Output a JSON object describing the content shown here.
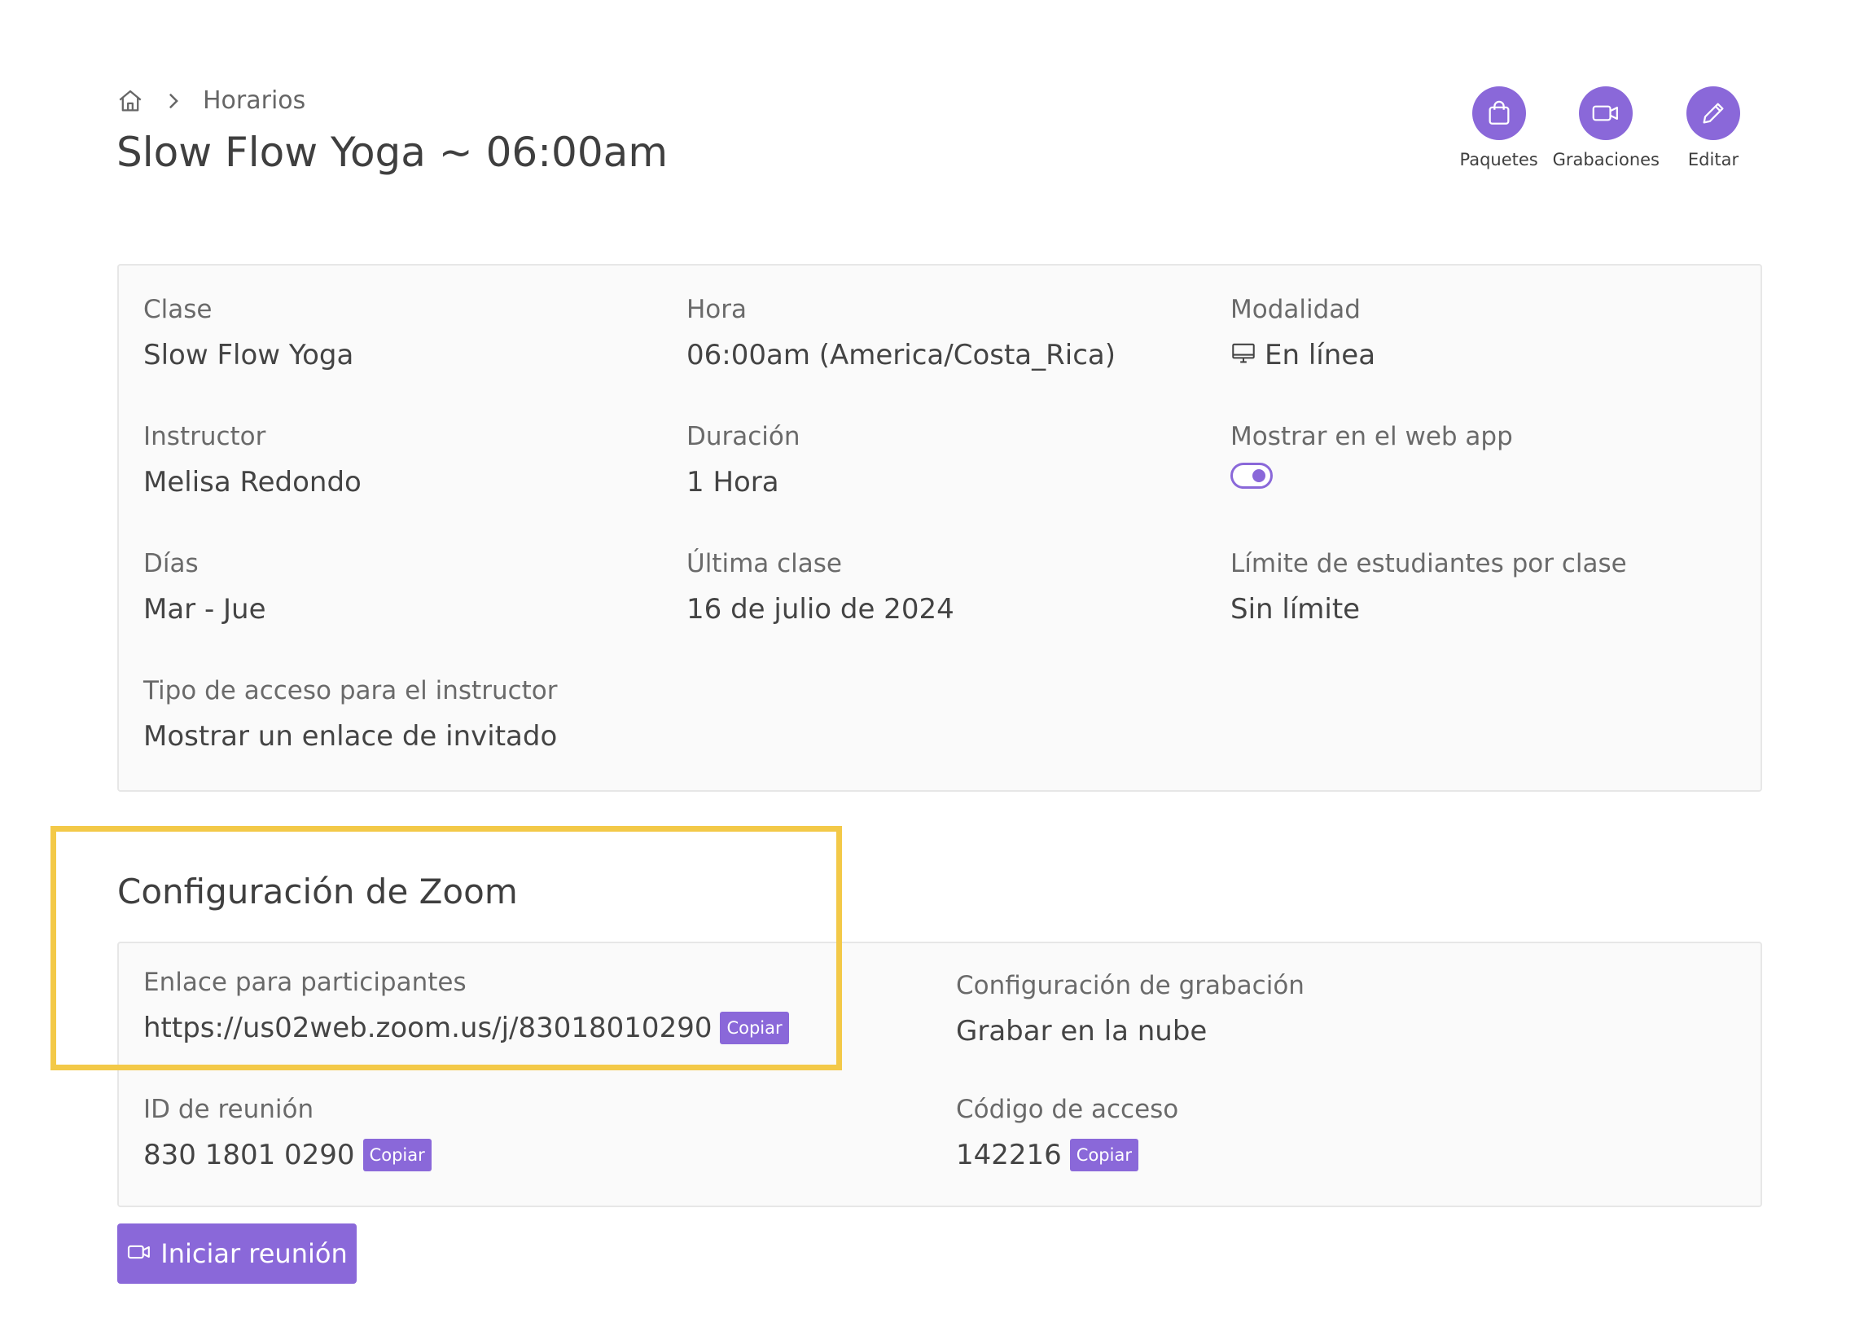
{
  "breadcrumb": {
    "home_icon": "home-icon",
    "separator_icon": "chevron-right-icon",
    "current": "Horarios"
  },
  "page_title": "Slow Flow Yoga ~ 06:00am",
  "actions": [
    {
      "label": "Paquetes",
      "icon": "shopping-bag-icon"
    },
    {
      "label": "Grabaciones",
      "icon": "video-camera-icon"
    },
    {
      "label": "Editar",
      "icon": "pencil-icon"
    }
  ],
  "info": {
    "clase": {
      "label": "Clase",
      "value": "Slow Flow Yoga"
    },
    "hora": {
      "label": "Hora",
      "value": "06:00am (America/Costa_Rica)"
    },
    "modalidad": {
      "label": "Modalidad",
      "value": "En línea",
      "icon": "monitor-icon"
    },
    "instructor": {
      "label": "Instructor",
      "value": "Melisa Redondo"
    },
    "duracion": {
      "label": "Duración",
      "value": "1 Hora"
    },
    "webapp": {
      "label": "Mostrar en el web app",
      "enabled": true
    },
    "dias": {
      "label": "Días",
      "value": "Mar - Jue"
    },
    "ultima": {
      "label": "Última clase",
      "value": "16 de julio de 2024"
    },
    "limite": {
      "label": "Límite de estudiantes por clase",
      "value": "Sin límite"
    },
    "acceso": {
      "label": "Tipo de acceso para el instructor",
      "value": "Mostrar un enlace de invitado"
    }
  },
  "zoom": {
    "title": "Configuración de Zoom",
    "enlace": {
      "label": "Enlace para participantes",
      "value": "https://us02web.zoom.us/j/83018010290",
      "copy": "Copiar"
    },
    "grabacion": {
      "label": "Configuración de grabación",
      "value": "Grabar en la nube"
    },
    "reunion_id": {
      "label": "ID de reunión",
      "value": "830 1801 0290",
      "copy": "Copiar"
    },
    "codigo": {
      "label": "Código de acceso",
      "value": "142216",
      "copy": "Copiar"
    }
  },
  "start_button": {
    "label": "Iniciar reunión",
    "icon": "video-camera-icon"
  },
  "colors": {
    "accent": "#8a68d9",
    "highlight": "#f3c948"
  }
}
